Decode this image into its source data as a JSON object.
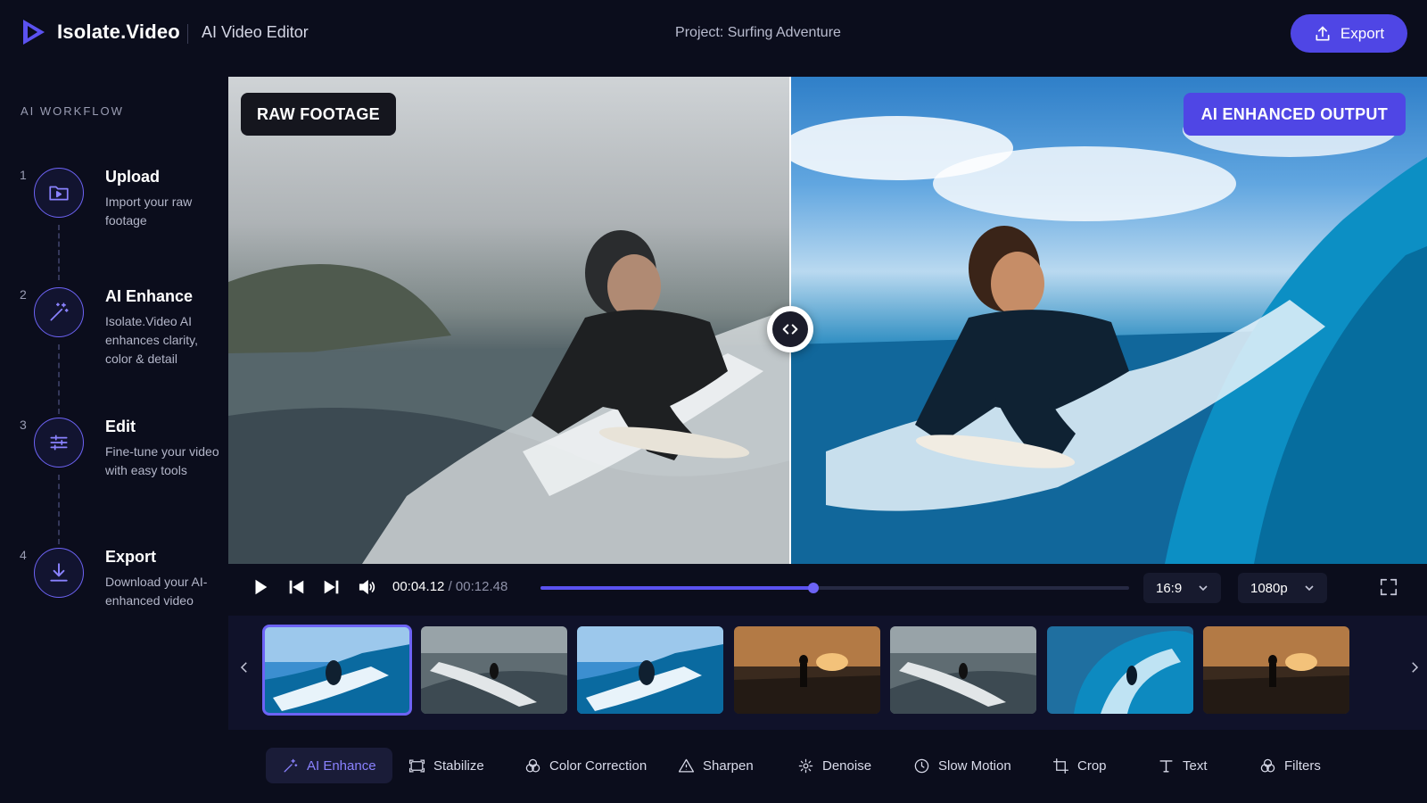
{
  "header": {
    "brand": "Isolate.Video",
    "subtitle": "AI Video Editor",
    "project": "Project: Surfing Adventure",
    "export_label": "Export"
  },
  "sidebar": {
    "title": "AI WORKFLOW",
    "steps": [
      {
        "num": "1",
        "title": "Upload",
        "desc": "Import your raw footage",
        "icon": "folder-icon"
      },
      {
        "num": "2",
        "title": "AI Enhance",
        "desc": "Isolate.Video AI enhances clarity, color & detail",
        "icon": "magic-wand-icon"
      },
      {
        "num": "3",
        "title": "Edit",
        "desc": "Fine-tune your video with easy tools",
        "icon": "sliders-icon"
      },
      {
        "num": "4",
        "title": "Export",
        "desc": "Download your AI-enhanced video",
        "icon": "download-icon"
      }
    ]
  },
  "preview": {
    "raw_label": "RAW FOOTAGE",
    "ai_label": "AI ENHANCED OUTPUT"
  },
  "playback": {
    "current_time": "00:04.12",
    "separator": "/",
    "total_time": "00:12.48",
    "progress": 0.4636,
    "aspect_ratio": "16:9",
    "resolution": "1080p"
  },
  "filmstrip": {
    "selected_index": 0,
    "thumbnails": [
      {
        "scene": "wave-blue"
      },
      {
        "scene": "wave-grey"
      },
      {
        "scene": "wave-blue"
      },
      {
        "scene": "sunset"
      },
      {
        "scene": "wave-grey"
      },
      {
        "scene": "barrel"
      },
      {
        "scene": "sunset"
      }
    ]
  },
  "tools": [
    {
      "label": "AI Enhance",
      "icon": "sparkle-wand-icon",
      "active": true
    },
    {
      "label": "Stabilize",
      "icon": "stabilize-icon",
      "active": false
    },
    {
      "label": "Color Correction",
      "icon": "color-circles-icon",
      "active": false
    },
    {
      "label": "Sharpen",
      "icon": "triangle-icon",
      "active": false
    },
    {
      "label": "Denoise",
      "icon": "denoise-icon",
      "active": false
    },
    {
      "label": "Slow Motion",
      "icon": "clock-icon",
      "active": false
    },
    {
      "label": "Crop",
      "icon": "crop-icon",
      "active": false
    },
    {
      "label": "Text",
      "icon": "text-icon",
      "active": false
    },
    {
      "label": "Filters",
      "icon": "filters-icon",
      "active": false
    }
  ],
  "colors": {
    "accent": "#4f46e5",
    "background": "#0b0d1c"
  }
}
